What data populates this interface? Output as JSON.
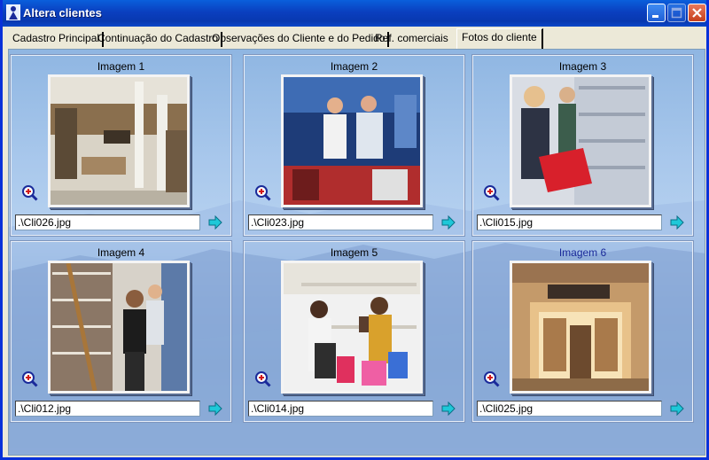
{
  "window": {
    "title": "Altera clientes"
  },
  "tabs": [
    {
      "label": "Cadastro Principal"
    },
    {
      "label": "Continuação do Cadastro"
    },
    {
      "label": "Observações do Cliente e do Pedido"
    },
    {
      "label": "Ref. comerciais"
    },
    {
      "label": "Fotos do cliente"
    }
  ],
  "images": [
    {
      "title": "Imagem 1",
      "path": ".\\Cli026.jpg"
    },
    {
      "title": "Imagem 2",
      "path": ".\\Cli023.jpg"
    },
    {
      "title": "Imagem 3",
      "path": ".\\Cli015.jpg"
    },
    {
      "title": "Imagem 4",
      "path": ".\\Cli012.jpg"
    },
    {
      "title": "Imagem 5",
      "path": ".\\Cli014.jpg"
    },
    {
      "title": "Imagem 6",
      "path": ".\\Cli025.jpg"
    }
  ],
  "icons": {
    "zoom": "zoom-in-icon",
    "go": "arrow-right-icon"
  },
  "colors": {
    "titlebar": "#0a3fbf",
    "active_image_title": "#1a2a9a",
    "go_arrow": "#1ec8d8"
  }
}
